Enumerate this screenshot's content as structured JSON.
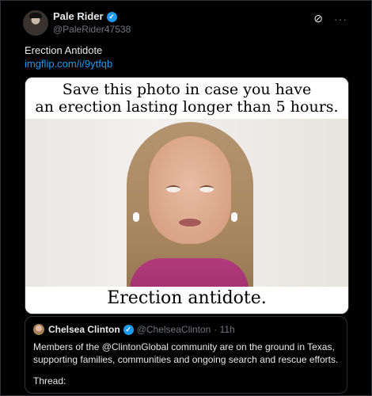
{
  "post": {
    "author": {
      "display_name": "Pale Rider",
      "handle": "@PaleRider47538",
      "verified": true
    },
    "text": "Erection Antidote",
    "link": "imgflip.com/i/9ytfqb",
    "icons": [
      "grok-icon",
      "more-icon"
    ]
  },
  "media": {
    "top_caption_line1": "Save this photo in case you have",
    "top_caption_line2": "an erection lasting longer than 5 hours.",
    "bottom_caption": "Erection antidote."
  },
  "quote": {
    "display_name": "Chelsea Clinton",
    "handle": "@ChelseaClinton",
    "time": "· 11h",
    "verified": true,
    "text": "Members of the @ClintonGlobal community are on the ground in Texas, supporting families, communities and ongoing search and rescue efforts.",
    "thread_label": "Thread:"
  },
  "colors": {
    "background": "#000000",
    "text": "#e7e9ea",
    "muted": "#71767b",
    "link": "#1d9bf0",
    "border": "#2f3336"
  }
}
